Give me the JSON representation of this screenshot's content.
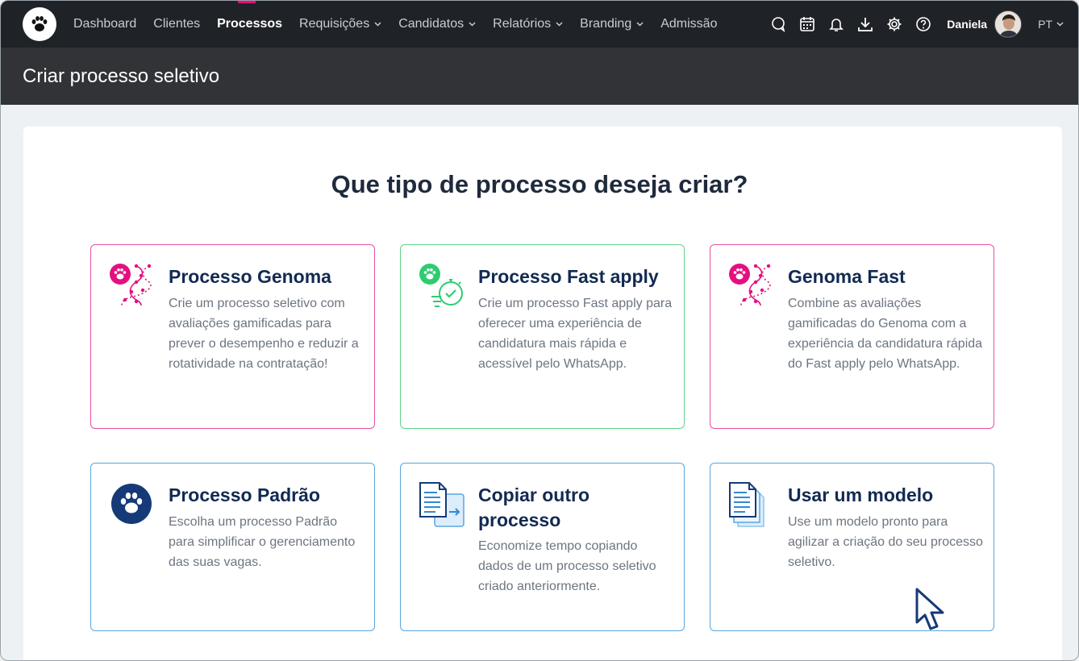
{
  "nav": {
    "items": [
      {
        "label": "Dashboard",
        "dropdown": false,
        "active": false
      },
      {
        "label": "Clientes",
        "dropdown": false,
        "active": false
      },
      {
        "label": "Processos",
        "dropdown": false,
        "active": true
      },
      {
        "label": "Requisições",
        "dropdown": true,
        "active": false
      },
      {
        "label": "Candidatos",
        "dropdown": true,
        "active": false
      },
      {
        "label": "Relatórios",
        "dropdown": true,
        "active": false
      },
      {
        "label": "Branding",
        "dropdown": true,
        "active": false
      },
      {
        "label": "Admissão",
        "dropdown": false,
        "active": false
      }
    ],
    "tools": [
      "chat-icon",
      "calendar-icon",
      "bell-icon",
      "download-icon",
      "gear-icon",
      "help-icon"
    ],
    "user_name": "Daniela",
    "language": "PT"
  },
  "page": {
    "title": "Criar processo seletivo",
    "heading": "Que tipo de processo deseja criar?"
  },
  "options": [
    {
      "title": "Processo Genoma",
      "description": "Crie um processo seletivo com avaliações gamificadas para prever o desempenho e reduzir a rotatividade na contratação!",
      "icon": "genoma-icon"
    },
    {
      "title": "Processo Fast apply",
      "description": "Crie um processo Fast apply para oferecer uma experiência de candidatura mais rápida e acessível pelo WhatsApp.",
      "icon": "fast-apply-icon"
    },
    {
      "title": "Genoma Fast",
      "description": "Combine as avaliações gamificadas do Genoma com a experiência da candidatura rápida do Fast apply pelo WhatsApp.",
      "icon": "genoma-fast-icon"
    },
    {
      "title": "Processo Padrão",
      "description": "Escolha um processo Padrão para simplificar o gerenciamento das suas vagas.",
      "icon": "paw-icon"
    },
    {
      "title": "Copiar outro processo",
      "description": "Economize tempo copiando dados de um processo seletivo criado anteriormente.",
      "icon": "copy-document-icon"
    },
    {
      "title": "Usar um modelo",
      "description": "Use um modelo pronto para agilizar a criação do seu processo seletivo.",
      "icon": "template-icon"
    }
  ],
  "colors": {
    "nav_bg": "#1f2226",
    "header_bg": "#313336",
    "accent_pink": "#e4107f",
    "accent_green": "#2ecc71",
    "accent_blue": "#5ba6dc",
    "title_navy": "#122a52"
  }
}
